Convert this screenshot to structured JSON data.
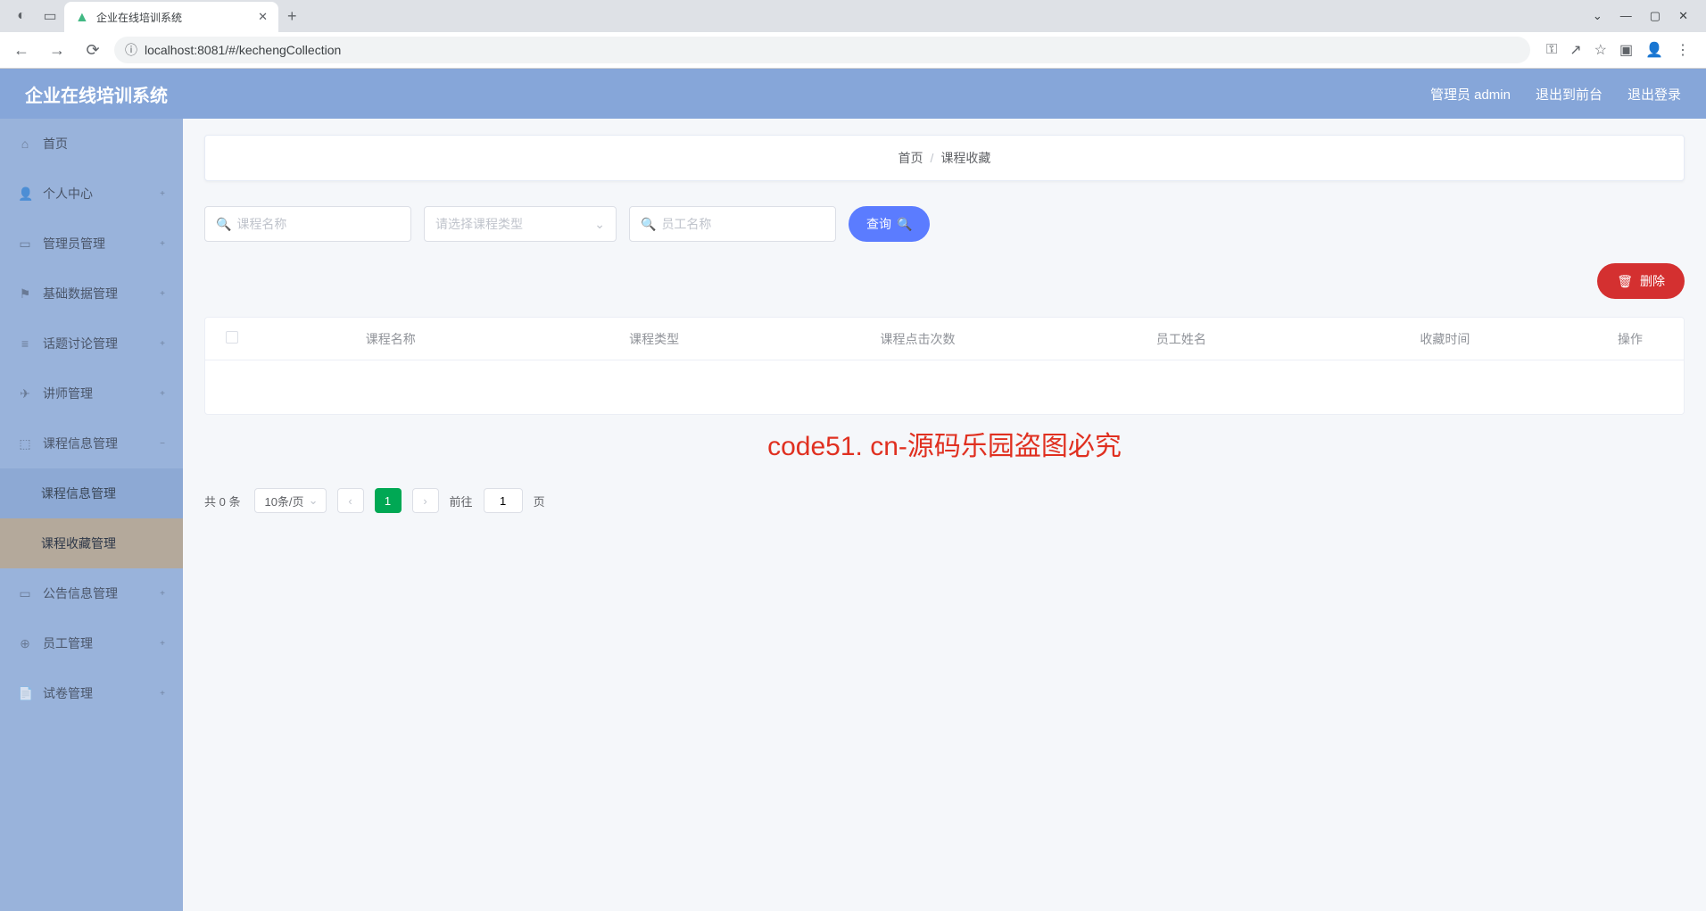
{
  "browser": {
    "tab_title": "企业在线培训系统",
    "url": "localhost:8081/#/kechengCollection",
    "new_tab": "+"
  },
  "header": {
    "title": "企业在线培训系统",
    "user_label": "管理员 admin",
    "back_to_front": "退出到前台",
    "logout": "退出登录"
  },
  "sidebar": {
    "items": [
      {
        "icon": "⌂",
        "label": "首页"
      },
      {
        "icon": "👤",
        "label": "个人中心",
        "expand": "+"
      },
      {
        "icon": "▭",
        "label": "管理员管理",
        "expand": "+"
      },
      {
        "icon": "⚑",
        "label": "基础数据管理",
        "expand": "+"
      },
      {
        "icon": "≡",
        "label": "话题讨论管理",
        "expand": "+"
      },
      {
        "icon": "✈",
        "label": "讲师管理",
        "expand": "+"
      },
      {
        "icon": "⬚",
        "label": "课程信息管理",
        "expand": "−"
      },
      {
        "label": "课程信息管理",
        "sub": true
      },
      {
        "label": "课程收藏管理",
        "sub": true,
        "active": true
      },
      {
        "icon": "▭",
        "label": "公告信息管理",
        "expand": "+"
      },
      {
        "icon": "⊕",
        "label": "员工管理",
        "expand": "+"
      },
      {
        "icon": "📄",
        "label": "试卷管理",
        "expand": "+"
      }
    ]
  },
  "breadcrumb": {
    "home": "首页",
    "sep": "/",
    "current": "课程收藏"
  },
  "filters": {
    "course_name_ph": "课程名称",
    "course_type_ph": "请选择课程类型",
    "employee_name_ph": "员工名称",
    "query_btn": "查询"
  },
  "actions": {
    "delete_btn": "删除"
  },
  "table": {
    "headers": [
      "",
      "课程名称",
      "课程类型",
      "课程点击次数",
      "员工姓名",
      "收藏时间",
      "操作"
    ]
  },
  "watermark_notice": "code51. cn-源码乐园盗图必究",
  "pagination": {
    "total": "共 0 条",
    "page_size": "10条/页",
    "prev": "‹",
    "page_1": "1",
    "next": "›",
    "goto_label": "前往",
    "goto_value": "1",
    "page_suffix": "页"
  },
  "watermark_text": "code51.cn"
}
